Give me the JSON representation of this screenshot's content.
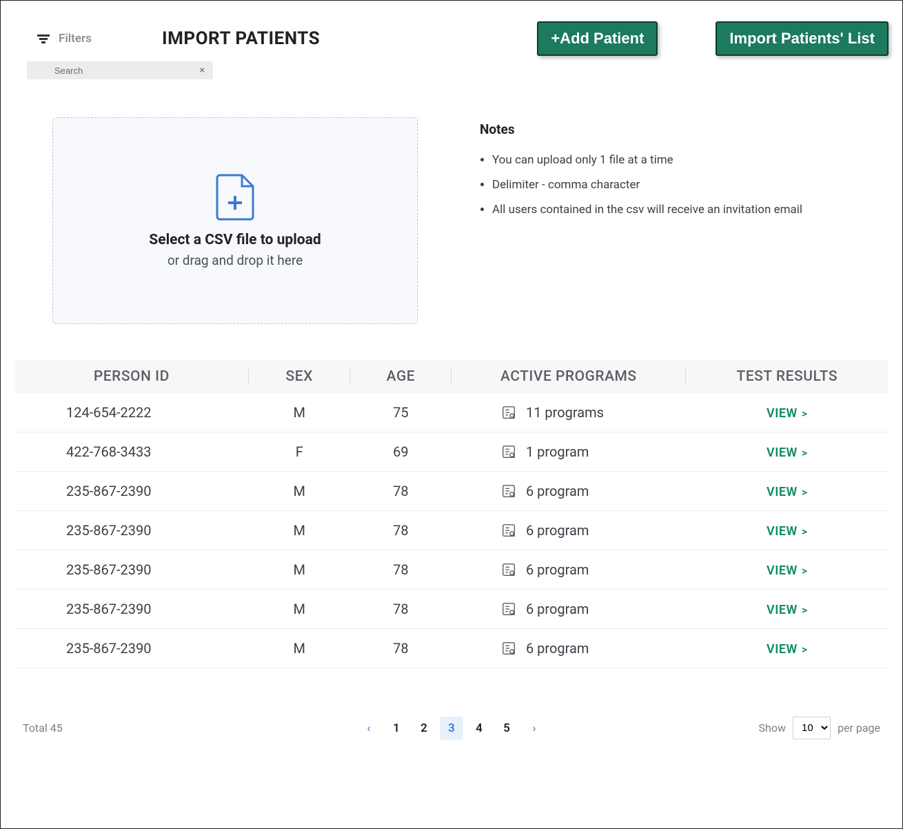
{
  "header": {
    "filters_label": "Filters",
    "page_title": "IMPORT PATIENTS",
    "add_patient_label": "+Add Patient",
    "import_list_label": "Import Patients' List"
  },
  "search": {
    "placeholder": "Search"
  },
  "upload": {
    "title": "Select a CSV file to upload",
    "subtitle": "or drag and drop it here"
  },
  "notes": {
    "title": "Notes",
    "items": [
      "You can upload only 1 file at a time",
      "Delimiter - comma character",
      "All users contained in the csv will receive an invitation email"
    ]
  },
  "table": {
    "headers": {
      "person_id": "PERSON ID",
      "sex": "SEX",
      "age": "AGE",
      "active_programs": "ACTIVE PROGRAMS",
      "test_results": "TEST RESULTS"
    },
    "view_label": "VIEW",
    "rows": [
      {
        "person_id": "124-654-2222",
        "sex": "M",
        "age": "75",
        "programs": "11 programs"
      },
      {
        "person_id": "422-768-3433",
        "sex": "F",
        "age": "69",
        "programs": "1 program"
      },
      {
        "person_id": "235-867-2390",
        "sex": "M",
        "age": "78",
        "programs": "6 program"
      },
      {
        "person_id": "235-867-2390",
        "sex": "M",
        "age": "78",
        "programs": "6 program"
      },
      {
        "person_id": "235-867-2390",
        "sex": "M",
        "age": "78",
        "programs": "6 program"
      },
      {
        "person_id": "235-867-2390",
        "sex": "M",
        "age": "78",
        "programs": "6 program"
      },
      {
        "person_id": "235-867-2390",
        "sex": "M",
        "age": "78",
        "programs": "6 program"
      }
    ]
  },
  "pagination": {
    "total_label": "Total 45",
    "pages": [
      "1",
      "2",
      "3",
      "4",
      "5"
    ],
    "active_page": "3",
    "show_label": "Show",
    "per_page_label": "per page",
    "page_size": "10"
  }
}
